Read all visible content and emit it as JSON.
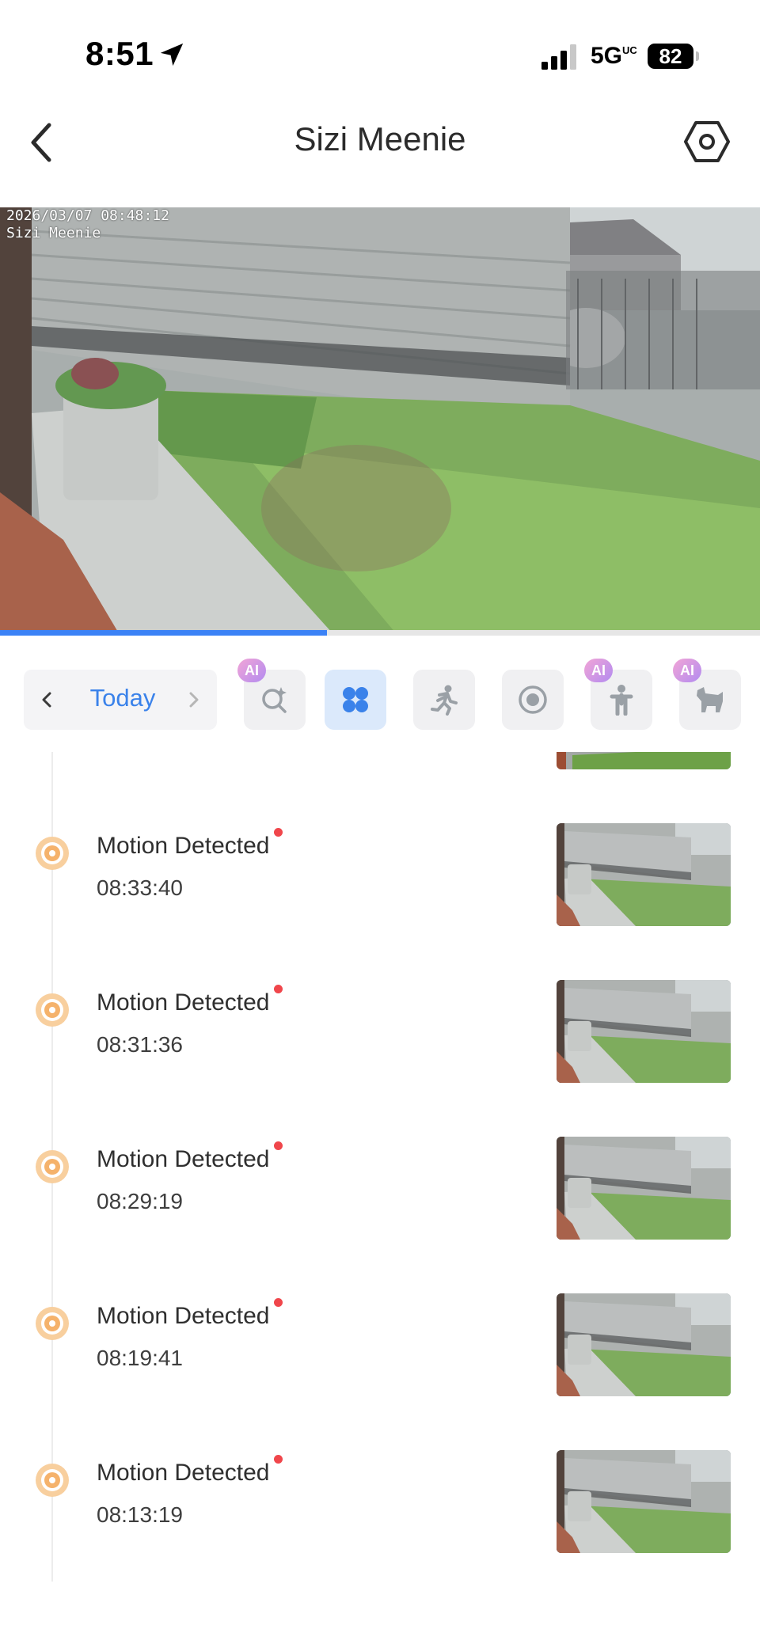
{
  "status_bar": {
    "time": "8:51",
    "network": "5G",
    "network_sup": "UC",
    "battery": "82"
  },
  "header": {
    "title": "Sizi Meenie"
  },
  "video": {
    "overlay_timestamp": "2026/03/07 08:48:12",
    "overlay_camera": "Sizi Meenie",
    "progress_percent": 43
  },
  "filter_bar": {
    "date_label": "Today",
    "filters": [
      {
        "name": "ai-search",
        "icon": "ai-search-icon",
        "ai": "AI",
        "active": false
      },
      {
        "name": "all-events",
        "icon": "grid-icon",
        "ai": "",
        "active": true
      },
      {
        "name": "motion",
        "icon": "running-person-icon",
        "ai": "",
        "active": false
      },
      {
        "name": "record",
        "icon": "record-icon",
        "ai": "",
        "active": false
      },
      {
        "name": "person",
        "icon": "person-icon",
        "ai": "AI",
        "active": false
      },
      {
        "name": "pet",
        "icon": "pet-icon",
        "ai": "AI",
        "active": false
      }
    ]
  },
  "events": [
    {
      "title": "Motion Detected",
      "time": "08:33:40"
    },
    {
      "title": "Motion Detected",
      "time": "08:31:36"
    },
    {
      "title": "Motion Detected",
      "time": "08:29:19"
    },
    {
      "title": "Motion Detected",
      "time": "08:19:41"
    },
    {
      "title": "Motion Detected",
      "time": "08:13:19"
    }
  ],
  "colors": {
    "accent": "#3b82f6",
    "event_icon": "#f5b26b",
    "unread_dot": "#f0464b"
  }
}
